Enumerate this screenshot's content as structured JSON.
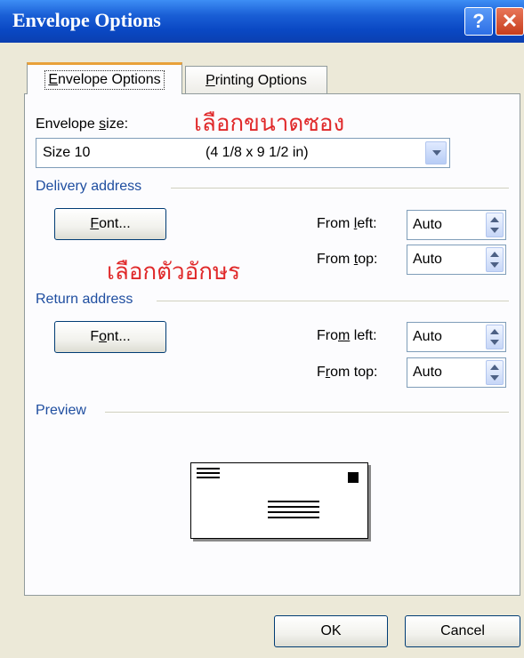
{
  "window": {
    "title": "Envelope Options",
    "help_glyph": "?",
    "close_glyph": "✕"
  },
  "tabs": [
    {
      "label": "Envelope Options",
      "mnemonic": "E",
      "rest": "nvelope Options",
      "active": true
    },
    {
      "label": "Printing Options",
      "mnemonic": "P",
      "rest": "rinting Options",
      "active": false
    }
  ],
  "envelope_size": {
    "label_pre": "Envelope ",
    "label_key": "s",
    "label_post": "ize:",
    "value": "Size 10",
    "dimensions": "(4 1/8 x 9 1/2 in)"
  },
  "annotations": {
    "size_note": "เลือกขนาดซอง",
    "font_note": "เลือกตัวอักษร"
  },
  "delivery": {
    "section": "Delivery address",
    "font_pre": "",
    "font_key": "F",
    "font_post": "ont...",
    "from_left_pre": "From ",
    "from_left_key": "l",
    "from_left_post": "eft:",
    "from_left_value": "Auto",
    "from_top_pre": "From ",
    "from_top_key": "t",
    "from_top_post": "op:",
    "from_top_value": "Auto"
  },
  "return": {
    "section": "Return address",
    "font_pre": "F",
    "font_key": "o",
    "font_post": "nt...",
    "from_left_pre": "Fro",
    "from_left_key": "m",
    "from_left_post": " left:",
    "from_left_value": "Auto",
    "from_top_pre": "F",
    "from_top_key": "r",
    "from_top_post": "om top:",
    "from_top_value": "Auto"
  },
  "preview": {
    "section": "Preview"
  },
  "footer": {
    "ok_label": "OK",
    "cancel_label": "Cancel"
  }
}
